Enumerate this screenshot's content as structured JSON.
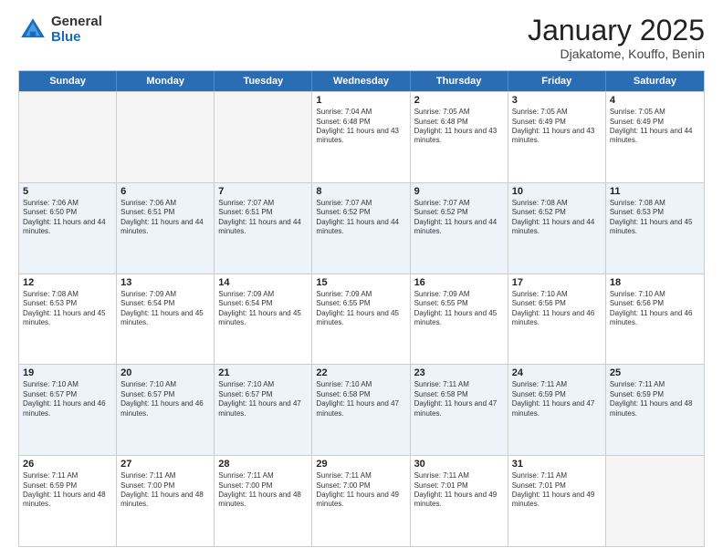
{
  "logo": {
    "general": "General",
    "blue": "Blue"
  },
  "title": {
    "month": "January 2025",
    "location": "Djakatome, Kouffo, Benin"
  },
  "weekdays": [
    "Sunday",
    "Monday",
    "Tuesday",
    "Wednesday",
    "Thursday",
    "Friday",
    "Saturday"
  ],
  "weeks": [
    [
      {
        "day": "",
        "sunrise": "",
        "sunset": "",
        "daylight": "",
        "empty": true
      },
      {
        "day": "",
        "sunrise": "",
        "sunset": "",
        "daylight": "",
        "empty": true
      },
      {
        "day": "",
        "sunrise": "",
        "sunset": "",
        "daylight": "",
        "empty": true
      },
      {
        "day": "1",
        "sunrise": "Sunrise: 7:04 AM",
        "sunset": "Sunset: 6:48 PM",
        "daylight": "Daylight: 11 hours and 43 minutes."
      },
      {
        "day": "2",
        "sunrise": "Sunrise: 7:05 AM",
        "sunset": "Sunset: 6:48 PM",
        "daylight": "Daylight: 11 hours and 43 minutes."
      },
      {
        "day": "3",
        "sunrise": "Sunrise: 7:05 AM",
        "sunset": "Sunset: 6:49 PM",
        "daylight": "Daylight: 11 hours and 43 minutes."
      },
      {
        "day": "4",
        "sunrise": "Sunrise: 7:05 AM",
        "sunset": "Sunset: 6:49 PM",
        "daylight": "Daylight: 11 hours and 44 minutes."
      }
    ],
    [
      {
        "day": "5",
        "sunrise": "Sunrise: 7:06 AM",
        "sunset": "Sunset: 6:50 PM",
        "daylight": "Daylight: 11 hours and 44 minutes."
      },
      {
        "day": "6",
        "sunrise": "Sunrise: 7:06 AM",
        "sunset": "Sunset: 6:51 PM",
        "daylight": "Daylight: 11 hours and 44 minutes."
      },
      {
        "day": "7",
        "sunrise": "Sunrise: 7:07 AM",
        "sunset": "Sunset: 6:51 PM",
        "daylight": "Daylight: 11 hours and 44 minutes."
      },
      {
        "day": "8",
        "sunrise": "Sunrise: 7:07 AM",
        "sunset": "Sunset: 6:52 PM",
        "daylight": "Daylight: 11 hours and 44 minutes."
      },
      {
        "day": "9",
        "sunrise": "Sunrise: 7:07 AM",
        "sunset": "Sunset: 6:52 PM",
        "daylight": "Daylight: 11 hours and 44 minutes."
      },
      {
        "day": "10",
        "sunrise": "Sunrise: 7:08 AM",
        "sunset": "Sunset: 6:52 PM",
        "daylight": "Daylight: 11 hours and 44 minutes."
      },
      {
        "day": "11",
        "sunrise": "Sunrise: 7:08 AM",
        "sunset": "Sunset: 6:53 PM",
        "daylight": "Daylight: 11 hours and 45 minutes."
      }
    ],
    [
      {
        "day": "12",
        "sunrise": "Sunrise: 7:08 AM",
        "sunset": "Sunset: 6:53 PM",
        "daylight": "Daylight: 11 hours and 45 minutes."
      },
      {
        "day": "13",
        "sunrise": "Sunrise: 7:09 AM",
        "sunset": "Sunset: 6:54 PM",
        "daylight": "Daylight: 11 hours and 45 minutes."
      },
      {
        "day": "14",
        "sunrise": "Sunrise: 7:09 AM",
        "sunset": "Sunset: 6:54 PM",
        "daylight": "Daylight: 11 hours and 45 minutes."
      },
      {
        "day": "15",
        "sunrise": "Sunrise: 7:09 AM",
        "sunset": "Sunset: 6:55 PM",
        "daylight": "Daylight: 11 hours and 45 minutes."
      },
      {
        "day": "16",
        "sunrise": "Sunrise: 7:09 AM",
        "sunset": "Sunset: 6:55 PM",
        "daylight": "Daylight: 11 hours and 45 minutes."
      },
      {
        "day": "17",
        "sunrise": "Sunrise: 7:10 AM",
        "sunset": "Sunset: 6:56 PM",
        "daylight": "Daylight: 11 hours and 46 minutes."
      },
      {
        "day": "18",
        "sunrise": "Sunrise: 7:10 AM",
        "sunset": "Sunset: 6:56 PM",
        "daylight": "Daylight: 11 hours and 46 minutes."
      }
    ],
    [
      {
        "day": "19",
        "sunrise": "Sunrise: 7:10 AM",
        "sunset": "Sunset: 6:57 PM",
        "daylight": "Daylight: 11 hours and 46 minutes."
      },
      {
        "day": "20",
        "sunrise": "Sunrise: 7:10 AM",
        "sunset": "Sunset: 6:57 PM",
        "daylight": "Daylight: 11 hours and 46 minutes."
      },
      {
        "day": "21",
        "sunrise": "Sunrise: 7:10 AM",
        "sunset": "Sunset: 6:57 PM",
        "daylight": "Daylight: 11 hours and 47 minutes."
      },
      {
        "day": "22",
        "sunrise": "Sunrise: 7:10 AM",
        "sunset": "Sunset: 6:58 PM",
        "daylight": "Daylight: 11 hours and 47 minutes."
      },
      {
        "day": "23",
        "sunrise": "Sunrise: 7:11 AM",
        "sunset": "Sunset: 6:58 PM",
        "daylight": "Daylight: 11 hours and 47 minutes."
      },
      {
        "day": "24",
        "sunrise": "Sunrise: 7:11 AM",
        "sunset": "Sunset: 6:59 PM",
        "daylight": "Daylight: 11 hours and 47 minutes."
      },
      {
        "day": "25",
        "sunrise": "Sunrise: 7:11 AM",
        "sunset": "Sunset: 6:59 PM",
        "daylight": "Daylight: 11 hours and 48 minutes."
      }
    ],
    [
      {
        "day": "26",
        "sunrise": "Sunrise: 7:11 AM",
        "sunset": "Sunset: 6:59 PM",
        "daylight": "Daylight: 11 hours and 48 minutes."
      },
      {
        "day": "27",
        "sunrise": "Sunrise: 7:11 AM",
        "sunset": "Sunset: 7:00 PM",
        "daylight": "Daylight: 11 hours and 48 minutes."
      },
      {
        "day": "28",
        "sunrise": "Sunrise: 7:11 AM",
        "sunset": "Sunset: 7:00 PM",
        "daylight": "Daylight: 11 hours and 48 minutes."
      },
      {
        "day": "29",
        "sunrise": "Sunrise: 7:11 AM",
        "sunset": "Sunset: 7:00 PM",
        "daylight": "Daylight: 11 hours and 49 minutes."
      },
      {
        "day": "30",
        "sunrise": "Sunrise: 7:11 AM",
        "sunset": "Sunset: 7:01 PM",
        "daylight": "Daylight: 11 hours and 49 minutes."
      },
      {
        "day": "31",
        "sunrise": "Sunrise: 7:11 AM",
        "sunset": "Sunset: 7:01 PM",
        "daylight": "Daylight: 11 hours and 49 minutes."
      },
      {
        "day": "",
        "sunrise": "",
        "sunset": "",
        "daylight": "",
        "empty": true
      }
    ]
  ]
}
